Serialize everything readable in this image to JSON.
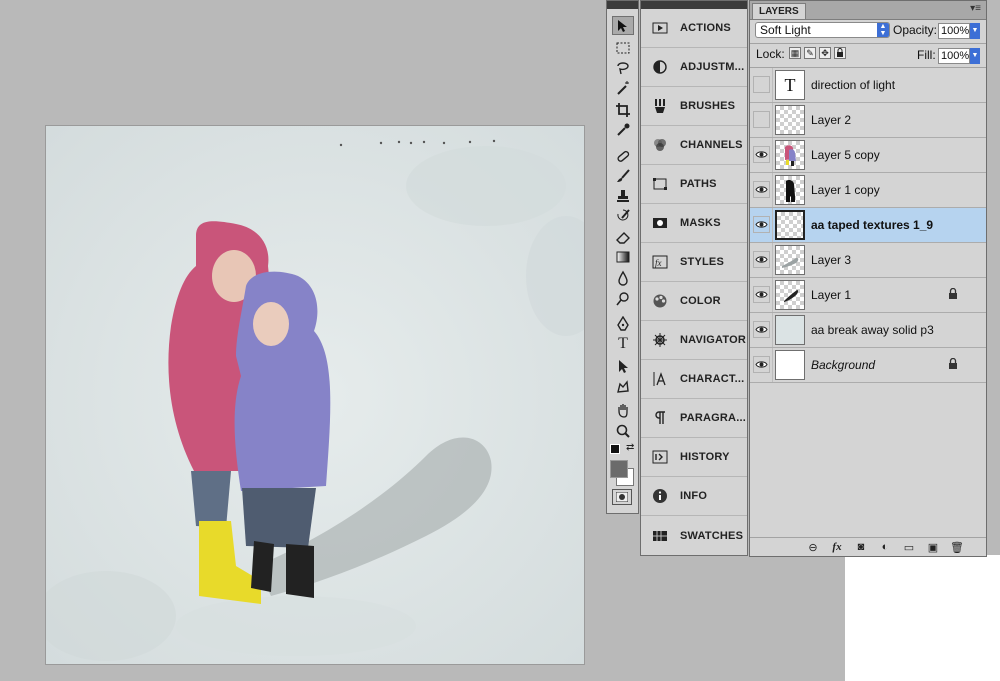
{
  "tools_panel": {
    "tools": [
      {
        "icon": "move-tool-icon"
      },
      {
        "icon": "marquee-tool-icon"
      },
      {
        "icon": "lasso-tool-icon"
      },
      {
        "icon": "magic-wand-tool-icon"
      },
      {
        "icon": "crop-tool-icon"
      },
      {
        "icon": "eyedropper-tool-icon"
      },
      {
        "icon": "healing-brush-tool-icon"
      },
      {
        "icon": "brush-tool-icon"
      },
      {
        "icon": "clone-stamp-tool-icon"
      },
      {
        "icon": "history-brush-tool-icon"
      },
      {
        "icon": "eraser-tool-icon"
      },
      {
        "icon": "gradient-tool-icon"
      },
      {
        "icon": "blur-tool-icon"
      },
      {
        "icon": "dodge-tool-icon"
      },
      {
        "icon": "pen-tool-icon"
      },
      {
        "icon": "type-tool-icon",
        "glyph": "T"
      },
      {
        "icon": "path-selection-tool-icon"
      },
      {
        "icon": "custom-shape-tool-icon"
      },
      {
        "icon": "hand-tool-icon"
      },
      {
        "icon": "zoom-tool-icon"
      }
    ],
    "foreground_color": "#6b6b6b",
    "background_color": "#ffffff"
  },
  "dock": {
    "items": [
      {
        "label": "ACTIONS",
        "icon": "actions-icon"
      },
      {
        "label": "ADJUSTM...",
        "icon": "adjustments-icon"
      },
      {
        "label": "BRUSHES",
        "icon": "brushes-icon"
      },
      {
        "label": "CHANNELS",
        "icon": "channels-icon"
      },
      {
        "label": "PATHS",
        "icon": "paths-icon"
      },
      {
        "label": "MASKS",
        "icon": "masks-icon"
      },
      {
        "label": "STYLES",
        "icon": "styles-icon"
      },
      {
        "label": "COLOR",
        "icon": "color-icon"
      },
      {
        "label": "NAVIGATOR",
        "icon": "navigator-icon"
      },
      {
        "label": "CHARACT...",
        "icon": "character-icon"
      },
      {
        "label": "PARAGRA...",
        "icon": "paragraph-icon"
      },
      {
        "label": "HISTORY",
        "icon": "history-icon"
      },
      {
        "label": "INFO",
        "icon": "info-icon"
      },
      {
        "label": "SWATCHES",
        "icon": "swatches-icon"
      }
    ]
  },
  "layers_panel": {
    "tab_label": "LAYERS",
    "blend_mode": "Soft Light",
    "opacity_label": "Opacity:",
    "opacity_value": "100%",
    "lock_label": "Lock:",
    "fill_label": "Fill:",
    "fill_value": "100%",
    "layers": [
      {
        "name": "direction of light",
        "visible": false,
        "thumb": "text",
        "thumb_glyph": "T",
        "locked": false,
        "selected": false
      },
      {
        "name": "Layer 2",
        "visible": false,
        "thumb": "checker",
        "locked": false,
        "selected": false
      },
      {
        "name": "Layer 5 copy",
        "visible": true,
        "thumb": "kids-color",
        "locked": false,
        "selected": false
      },
      {
        "name": "Layer 1 copy",
        "visible": true,
        "thumb": "kids-silhouette",
        "locked": false,
        "selected": false
      },
      {
        "name": "aa taped textures 1_9",
        "visible": true,
        "thumb": "checker",
        "locked": false,
        "selected": true
      },
      {
        "name": "Layer 3",
        "visible": true,
        "thumb": "shadow",
        "locked": false,
        "selected": false
      },
      {
        "name": "Layer 1",
        "visible": true,
        "thumb": "shadow-dark",
        "locked": true,
        "selected": false
      },
      {
        "name": "aa break away solid p3",
        "visible": true,
        "thumb": "solid-paper",
        "locked": false,
        "selected": false
      },
      {
        "name": "Background",
        "visible": true,
        "thumb": "white",
        "locked": true,
        "selected": false
      }
    ],
    "footer_buttons": [
      {
        "icon": "link-layers-icon",
        "glyph": "⊖"
      },
      {
        "icon": "layer-style-icon",
        "glyph": "fx"
      },
      {
        "icon": "add-mask-icon",
        "glyph": "◙"
      },
      {
        "icon": "adjustment-layer-icon",
        "glyph": "◐"
      },
      {
        "icon": "new-group-icon",
        "glyph": "▭"
      },
      {
        "icon": "new-layer-icon",
        "glyph": "▣"
      },
      {
        "icon": "trash-icon",
        "glyph": "🗑"
      }
    ]
  },
  "colors": {
    "workspace": "#b9b9b9",
    "panel": "#d4d4d4",
    "selection": "#b6d3ef",
    "paper": "#dde5e6"
  }
}
